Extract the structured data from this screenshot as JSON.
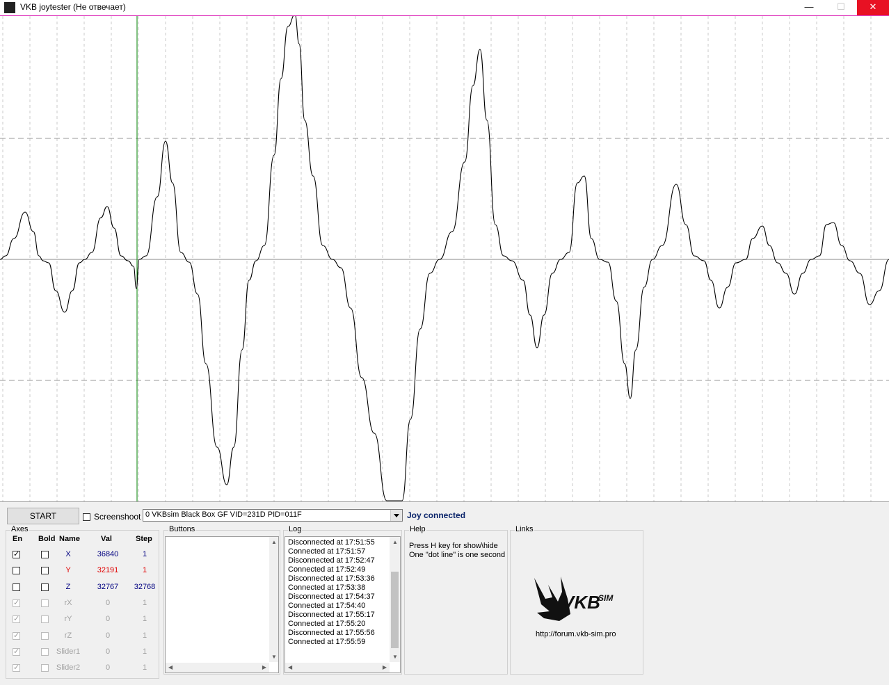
{
  "window": {
    "title": "VKB joytester (Не отвечает)",
    "minimize": "—",
    "maximize": "☐",
    "close": "✕"
  },
  "toolbar": {
    "start_label": "START",
    "screenshot_label": "Screenshoot",
    "device": "0 VKBsim Black Box GF  VID=231D PID=011F",
    "status": "Joy connected"
  },
  "axes": {
    "legend": "Axes",
    "headers": {
      "en": "En",
      "bold": "Bold",
      "name": "Name",
      "val": "Val",
      "step": "Step"
    },
    "rows": [
      {
        "name": "X",
        "val": "36840",
        "step": "1",
        "en": true,
        "bold": false,
        "enabled": true,
        "color": "#000080"
      },
      {
        "name": "Y",
        "val": "32191",
        "step": "1",
        "en": false,
        "bold": false,
        "enabled": true,
        "color": "#e00000"
      },
      {
        "name": "Z",
        "val": "32767",
        "step": "32768",
        "en": false,
        "bold": false,
        "enabled": true,
        "color": "#000080"
      },
      {
        "name": "rX",
        "val": "0",
        "step": "1",
        "en": true,
        "bold": false,
        "enabled": false,
        "color": "#a0a0a0"
      },
      {
        "name": "rY",
        "val": "0",
        "step": "1",
        "en": true,
        "bold": false,
        "enabled": false,
        "color": "#a0a0a0"
      },
      {
        "name": "rZ",
        "val": "0",
        "step": "1",
        "en": true,
        "bold": false,
        "enabled": false,
        "color": "#a0a0a0"
      },
      {
        "name": "Slider1",
        "val": "0",
        "step": "1",
        "en": true,
        "bold": false,
        "enabled": false,
        "color": "#a0a0a0"
      },
      {
        "name": "Slider2",
        "val": "0",
        "step": "1",
        "en": true,
        "bold": false,
        "enabled": false,
        "color": "#a0a0a0"
      }
    ]
  },
  "buttons": {
    "legend": "Buttons"
  },
  "log": {
    "legend": "Log",
    "lines": [
      "Disconnected at 17:51:55",
      "Connected at 17:51:57",
      "Disconnected at 17:52:47",
      "Connected at 17:52:49",
      "Disconnected at 17:53:36",
      "Connected at 17:53:38",
      "Disconnected at 17:54:37",
      "Connected at 17:54:40",
      "Disconnected at 17:55:17",
      "Connected at 17:55:20",
      "Disconnected at 17:55:56",
      "Connected at 17:55:59"
    ]
  },
  "help": {
    "legend": "Help",
    "line1": "Press H key for show\\hide",
    "line2": "One \"dot line\" is one second"
  },
  "links": {
    "legend": "Links",
    "logo_text": "VKB",
    "logo_sup": "SIM",
    "url": "http://forum.vkb-sim.pro"
  },
  "colors": {
    "accent_status": "#0a246a",
    "trace": "#000000",
    "cursor": "#008000",
    "close": "#e81123"
  }
}
